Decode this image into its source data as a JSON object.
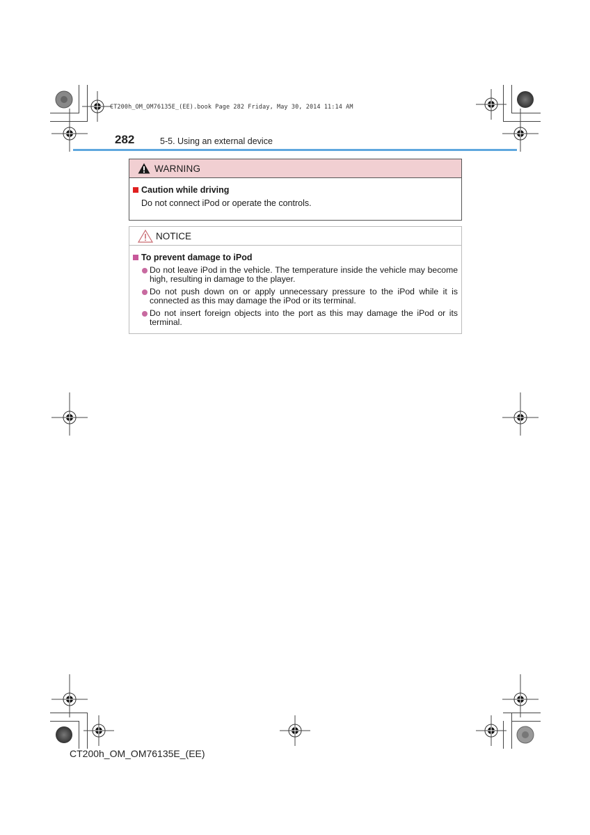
{
  "slug": "CT200h_OM_OM76135E_(EE).book  Page 282  Friday, May 30, 2014  11:14 AM",
  "header": {
    "page_number": "282",
    "section_title": "5-5. Using an external device",
    "rule_color": "#5fa7de"
  },
  "warning": {
    "icon": "warning-triangle-icon",
    "label": "WARNING",
    "header_bg": "#f1cfd2",
    "bullet_color": "#e02020",
    "title": "Caution while driving",
    "text": "Do not connect iPod or operate the controls."
  },
  "notice": {
    "icon": "notice-triangle-icon",
    "label": "NOTICE",
    "bullet_color": "#c86aa0",
    "title": "To prevent damage to iPod",
    "items": [
      "Do not leave iPod in the vehicle. The temperature inside the vehicle may become high, resulting in damage to the player.",
      "Do not push down on or apply unnecessary pressure to the iPod while it is connected as this may damage the iPod or its terminal.",
      "Do not insert foreign objects into the port as this may damage the iPod or its terminal."
    ]
  },
  "footer": {
    "code": "CT200h_OM_OM76135E_(EE)"
  }
}
